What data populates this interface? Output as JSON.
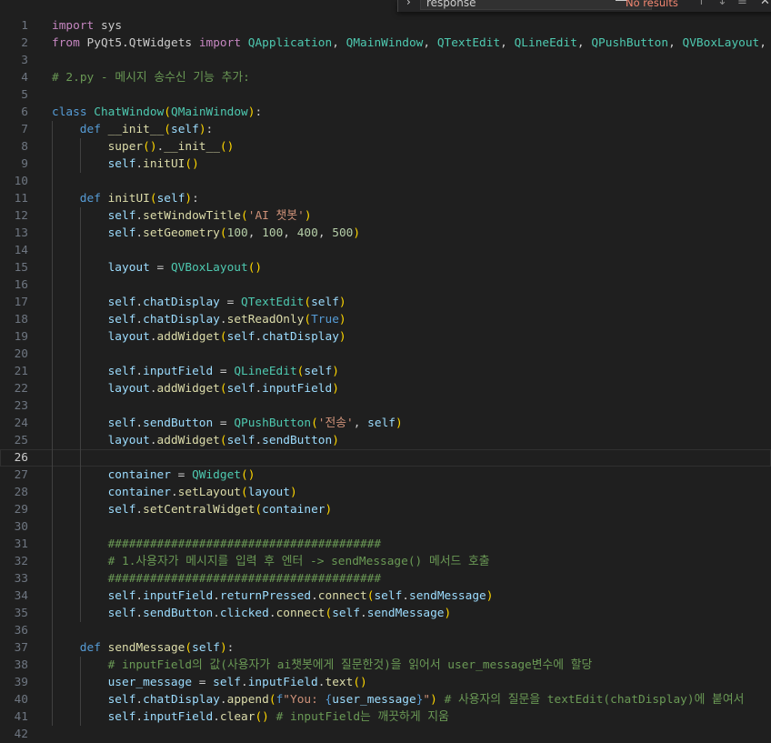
{
  "find_widget": {
    "query": "response",
    "match_case": "Aa",
    "whole_word": "ab",
    "regex": ".*",
    "status": "No results",
    "prev": "↑",
    "next": "↓",
    "menu": "≡",
    "close": "✕",
    "toggle": "›"
  },
  "editor": {
    "current_line": 26,
    "lines": [
      {
        "n": "1",
        "indent": 0,
        "t": [
          [
            "kw",
            "import"
          ],
          [
            "txt",
            " "
          ],
          [
            "txt",
            "sys"
          ]
        ]
      },
      {
        "n": "2",
        "indent": 0,
        "t": [
          [
            "kw",
            "from"
          ],
          [
            "txt",
            " PyQt5.QtWidgets "
          ],
          [
            "kw",
            "import"
          ],
          [
            "txt",
            " "
          ],
          [
            "cls",
            "QApplication"
          ],
          [
            "txt",
            ", "
          ],
          [
            "cls",
            "QMainWindow"
          ],
          [
            "txt",
            ", "
          ],
          [
            "cls",
            "QTextEdit"
          ],
          [
            "txt",
            ", "
          ],
          [
            "cls",
            "QLineEdit"
          ],
          [
            "txt",
            ", "
          ],
          [
            "cls",
            "QPushButton"
          ],
          [
            "txt",
            ", "
          ],
          [
            "cls",
            "QVBoxLayout"
          ],
          [
            "txt",
            ","
          ]
        ]
      },
      {
        "n": "3",
        "indent": 0,
        "t": []
      },
      {
        "n": "4",
        "indent": 0,
        "t": [
          [
            "cm",
            "# 2.py - 메시지 송수신 기능 추가:"
          ]
        ]
      },
      {
        "n": "5",
        "indent": 0,
        "t": []
      },
      {
        "n": "6",
        "indent": 0,
        "t": [
          [
            "def",
            "class"
          ],
          [
            "txt",
            " "
          ],
          [
            "cls",
            "ChatWindow"
          ],
          [
            "b1",
            "("
          ],
          [
            "cls",
            "QMainWindow"
          ],
          [
            "b1",
            ")"
          ],
          [
            "txt",
            ":"
          ]
        ]
      },
      {
        "n": "7",
        "indent": 1,
        "t": [
          [
            "def",
            "def"
          ],
          [
            "txt",
            " "
          ],
          [
            "fn",
            "__init__"
          ],
          [
            "b1",
            "("
          ],
          [
            "var",
            "self"
          ],
          [
            "b1",
            ")"
          ],
          [
            "txt",
            ":"
          ]
        ]
      },
      {
        "n": "8",
        "indent": 2,
        "t": [
          [
            "fn",
            "super"
          ],
          [
            "b1",
            "()"
          ],
          [
            "txt",
            "."
          ],
          [
            "fn",
            "__init__"
          ],
          [
            "b1",
            "()"
          ]
        ]
      },
      {
        "n": "9",
        "indent": 2,
        "t": [
          [
            "var",
            "self"
          ],
          [
            "txt",
            "."
          ],
          [
            "fn",
            "initUI"
          ],
          [
            "b1",
            "()"
          ]
        ]
      },
      {
        "n": "10",
        "indent": 1,
        "t": []
      },
      {
        "n": "11",
        "indent": 1,
        "t": [
          [
            "def",
            "def"
          ],
          [
            "txt",
            " "
          ],
          [
            "fn",
            "initUI"
          ],
          [
            "b1",
            "("
          ],
          [
            "var",
            "self"
          ],
          [
            "b1",
            ")"
          ],
          [
            "txt",
            ":"
          ]
        ]
      },
      {
        "n": "12",
        "indent": 2,
        "t": [
          [
            "var",
            "self"
          ],
          [
            "txt",
            "."
          ],
          [
            "fn",
            "setWindowTitle"
          ],
          [
            "b1",
            "("
          ],
          [
            "str",
            "'AI 챗봇'"
          ],
          [
            "b1",
            ")"
          ]
        ]
      },
      {
        "n": "13",
        "indent": 2,
        "t": [
          [
            "var",
            "self"
          ],
          [
            "txt",
            "."
          ],
          [
            "fn",
            "setGeometry"
          ],
          [
            "b1",
            "("
          ],
          [
            "num",
            "100"
          ],
          [
            "txt",
            ", "
          ],
          [
            "num",
            "100"
          ],
          [
            "txt",
            ", "
          ],
          [
            "num",
            "400"
          ],
          [
            "txt",
            ", "
          ],
          [
            "num",
            "500"
          ],
          [
            "b1",
            ")"
          ]
        ]
      },
      {
        "n": "14",
        "indent": 2,
        "t": []
      },
      {
        "n": "15",
        "indent": 2,
        "t": [
          [
            "var",
            "layout"
          ],
          [
            "txt",
            " = "
          ],
          [
            "cls",
            "QVBoxLayout"
          ],
          [
            "b1",
            "()"
          ]
        ]
      },
      {
        "n": "16",
        "indent": 2,
        "t": []
      },
      {
        "n": "17",
        "indent": 2,
        "t": [
          [
            "var",
            "self"
          ],
          [
            "txt",
            "."
          ],
          [
            "var",
            "chatDisplay"
          ],
          [
            "txt",
            " = "
          ],
          [
            "cls",
            "QTextEdit"
          ],
          [
            "b1",
            "("
          ],
          [
            "var",
            "self"
          ],
          [
            "b1",
            ")"
          ]
        ]
      },
      {
        "n": "18",
        "indent": 2,
        "t": [
          [
            "var",
            "self"
          ],
          [
            "txt",
            "."
          ],
          [
            "var",
            "chatDisplay"
          ],
          [
            "txt",
            "."
          ],
          [
            "fn",
            "setReadOnly"
          ],
          [
            "b1",
            "("
          ],
          [
            "def",
            "True"
          ],
          [
            "b1",
            ")"
          ]
        ]
      },
      {
        "n": "19",
        "indent": 2,
        "t": [
          [
            "var",
            "layout"
          ],
          [
            "txt",
            "."
          ],
          [
            "fn",
            "addWidget"
          ],
          [
            "b1",
            "("
          ],
          [
            "var",
            "self"
          ],
          [
            "txt",
            "."
          ],
          [
            "var",
            "chatDisplay"
          ],
          [
            "b1",
            ")"
          ]
        ]
      },
      {
        "n": "20",
        "indent": 2,
        "t": []
      },
      {
        "n": "21",
        "indent": 2,
        "t": [
          [
            "var",
            "self"
          ],
          [
            "txt",
            "."
          ],
          [
            "var",
            "inputField"
          ],
          [
            "txt",
            " = "
          ],
          [
            "cls",
            "QLineEdit"
          ],
          [
            "b1",
            "("
          ],
          [
            "var",
            "self"
          ],
          [
            "b1",
            ")"
          ]
        ]
      },
      {
        "n": "22",
        "indent": 2,
        "t": [
          [
            "var",
            "layout"
          ],
          [
            "txt",
            "."
          ],
          [
            "fn",
            "addWidget"
          ],
          [
            "b1",
            "("
          ],
          [
            "var",
            "self"
          ],
          [
            "txt",
            "."
          ],
          [
            "var",
            "inputField"
          ],
          [
            "b1",
            ")"
          ]
        ]
      },
      {
        "n": "23",
        "indent": 2,
        "t": []
      },
      {
        "n": "24",
        "indent": 2,
        "t": [
          [
            "var",
            "self"
          ],
          [
            "txt",
            "."
          ],
          [
            "var",
            "sendButton"
          ],
          [
            "txt",
            " = "
          ],
          [
            "cls",
            "QPushButton"
          ],
          [
            "b1",
            "("
          ],
          [
            "str",
            "'전송'"
          ],
          [
            "txt",
            ", "
          ],
          [
            "var",
            "self"
          ],
          [
            "b1",
            ")"
          ]
        ]
      },
      {
        "n": "25",
        "indent": 2,
        "t": [
          [
            "var",
            "layout"
          ],
          [
            "txt",
            "."
          ],
          [
            "fn",
            "addWidget"
          ],
          [
            "b1",
            "("
          ],
          [
            "var",
            "self"
          ],
          [
            "txt",
            "."
          ],
          [
            "var",
            "sendButton"
          ],
          [
            "b1",
            ")"
          ]
        ]
      },
      {
        "n": "26",
        "indent": 2,
        "t": []
      },
      {
        "n": "27",
        "indent": 2,
        "t": [
          [
            "var",
            "container"
          ],
          [
            "txt",
            " = "
          ],
          [
            "cls",
            "QWidget"
          ],
          [
            "b1",
            "()"
          ]
        ]
      },
      {
        "n": "28",
        "indent": 2,
        "t": [
          [
            "var",
            "container"
          ],
          [
            "txt",
            "."
          ],
          [
            "fn",
            "setLayout"
          ],
          [
            "b1",
            "("
          ],
          [
            "var",
            "layout"
          ],
          [
            "b1",
            ")"
          ]
        ]
      },
      {
        "n": "29",
        "indent": 2,
        "t": [
          [
            "var",
            "self"
          ],
          [
            "txt",
            "."
          ],
          [
            "fn",
            "setCentralWidget"
          ],
          [
            "b1",
            "("
          ],
          [
            "var",
            "container"
          ],
          [
            "b1",
            ")"
          ]
        ]
      },
      {
        "n": "30",
        "indent": 2,
        "t": []
      },
      {
        "n": "31",
        "indent": 2,
        "t": [
          [
            "cm",
            "#######################################"
          ]
        ]
      },
      {
        "n": "32",
        "indent": 2,
        "t": [
          [
            "cm",
            "# 1.사용자가 메시지를 입력 후 엔터 -> sendMessage() 메서드 호출"
          ]
        ]
      },
      {
        "n": "33",
        "indent": 2,
        "t": [
          [
            "cm",
            "#######################################"
          ]
        ]
      },
      {
        "n": "34",
        "indent": 2,
        "t": [
          [
            "var",
            "self"
          ],
          [
            "txt",
            "."
          ],
          [
            "var",
            "inputField"
          ],
          [
            "txt",
            "."
          ],
          [
            "var",
            "returnPressed"
          ],
          [
            "txt",
            "."
          ],
          [
            "fn",
            "connect"
          ],
          [
            "b1",
            "("
          ],
          [
            "var",
            "self"
          ],
          [
            "txt",
            "."
          ],
          [
            "var",
            "sendMessage"
          ],
          [
            "b1",
            ")"
          ]
        ]
      },
      {
        "n": "35",
        "indent": 2,
        "t": [
          [
            "var",
            "self"
          ],
          [
            "txt",
            "."
          ],
          [
            "var",
            "sendButton"
          ],
          [
            "txt",
            "."
          ],
          [
            "var",
            "clicked"
          ],
          [
            "txt",
            "."
          ],
          [
            "fn",
            "connect"
          ],
          [
            "b1",
            "("
          ],
          [
            "var",
            "self"
          ],
          [
            "txt",
            "."
          ],
          [
            "var",
            "sendMessage"
          ],
          [
            "b1",
            ")"
          ]
        ]
      },
      {
        "n": "36",
        "indent": 1,
        "t": []
      },
      {
        "n": "37",
        "indent": 1,
        "t": [
          [
            "def",
            "def"
          ],
          [
            "txt",
            " "
          ],
          [
            "fn",
            "sendMessage"
          ],
          [
            "b1",
            "("
          ],
          [
            "var",
            "self"
          ],
          [
            "b1",
            ")"
          ],
          [
            "txt",
            ":"
          ]
        ]
      },
      {
        "n": "38",
        "indent": 2,
        "t": [
          [
            "cm",
            "# inputField의 값(사용자가 ai챗봇에게 질문한것)을 읽어서 user_message변수에 할당"
          ]
        ]
      },
      {
        "n": "39",
        "indent": 2,
        "t": [
          [
            "var",
            "user_message"
          ],
          [
            "txt",
            " = "
          ],
          [
            "var",
            "self"
          ],
          [
            "txt",
            "."
          ],
          [
            "var",
            "inputField"
          ],
          [
            "txt",
            "."
          ],
          [
            "fn",
            "text"
          ],
          [
            "b1",
            "()"
          ]
        ]
      },
      {
        "n": "40",
        "indent": 2,
        "t": [
          [
            "var",
            "self"
          ],
          [
            "txt",
            "."
          ],
          [
            "var",
            "chatDisplay"
          ],
          [
            "txt",
            "."
          ],
          [
            "fn",
            "append"
          ],
          [
            "b1",
            "("
          ],
          [
            "def",
            "f"
          ],
          [
            "str",
            "\"You: "
          ],
          [
            "def",
            "{"
          ],
          [
            "var",
            "user_message"
          ],
          [
            "def",
            "}"
          ],
          [
            "str",
            "\""
          ],
          [
            "b1",
            ")"
          ],
          [
            "txt",
            " "
          ],
          [
            "cm",
            "# 사용자의 질문을 textEdit(chatDisplay)에 붙여서"
          ]
        ]
      },
      {
        "n": "41",
        "indent": 2,
        "t": [
          [
            "var",
            "self"
          ],
          [
            "txt",
            "."
          ],
          [
            "var",
            "inputField"
          ],
          [
            "txt",
            "."
          ],
          [
            "fn",
            "clear"
          ],
          [
            "b1",
            "()"
          ],
          [
            "txt",
            " "
          ],
          [
            "cm",
            "# inputField는 깨끗하게 지움"
          ]
        ]
      },
      {
        "n": "42",
        "indent": 0,
        "t": []
      }
    ]
  }
}
